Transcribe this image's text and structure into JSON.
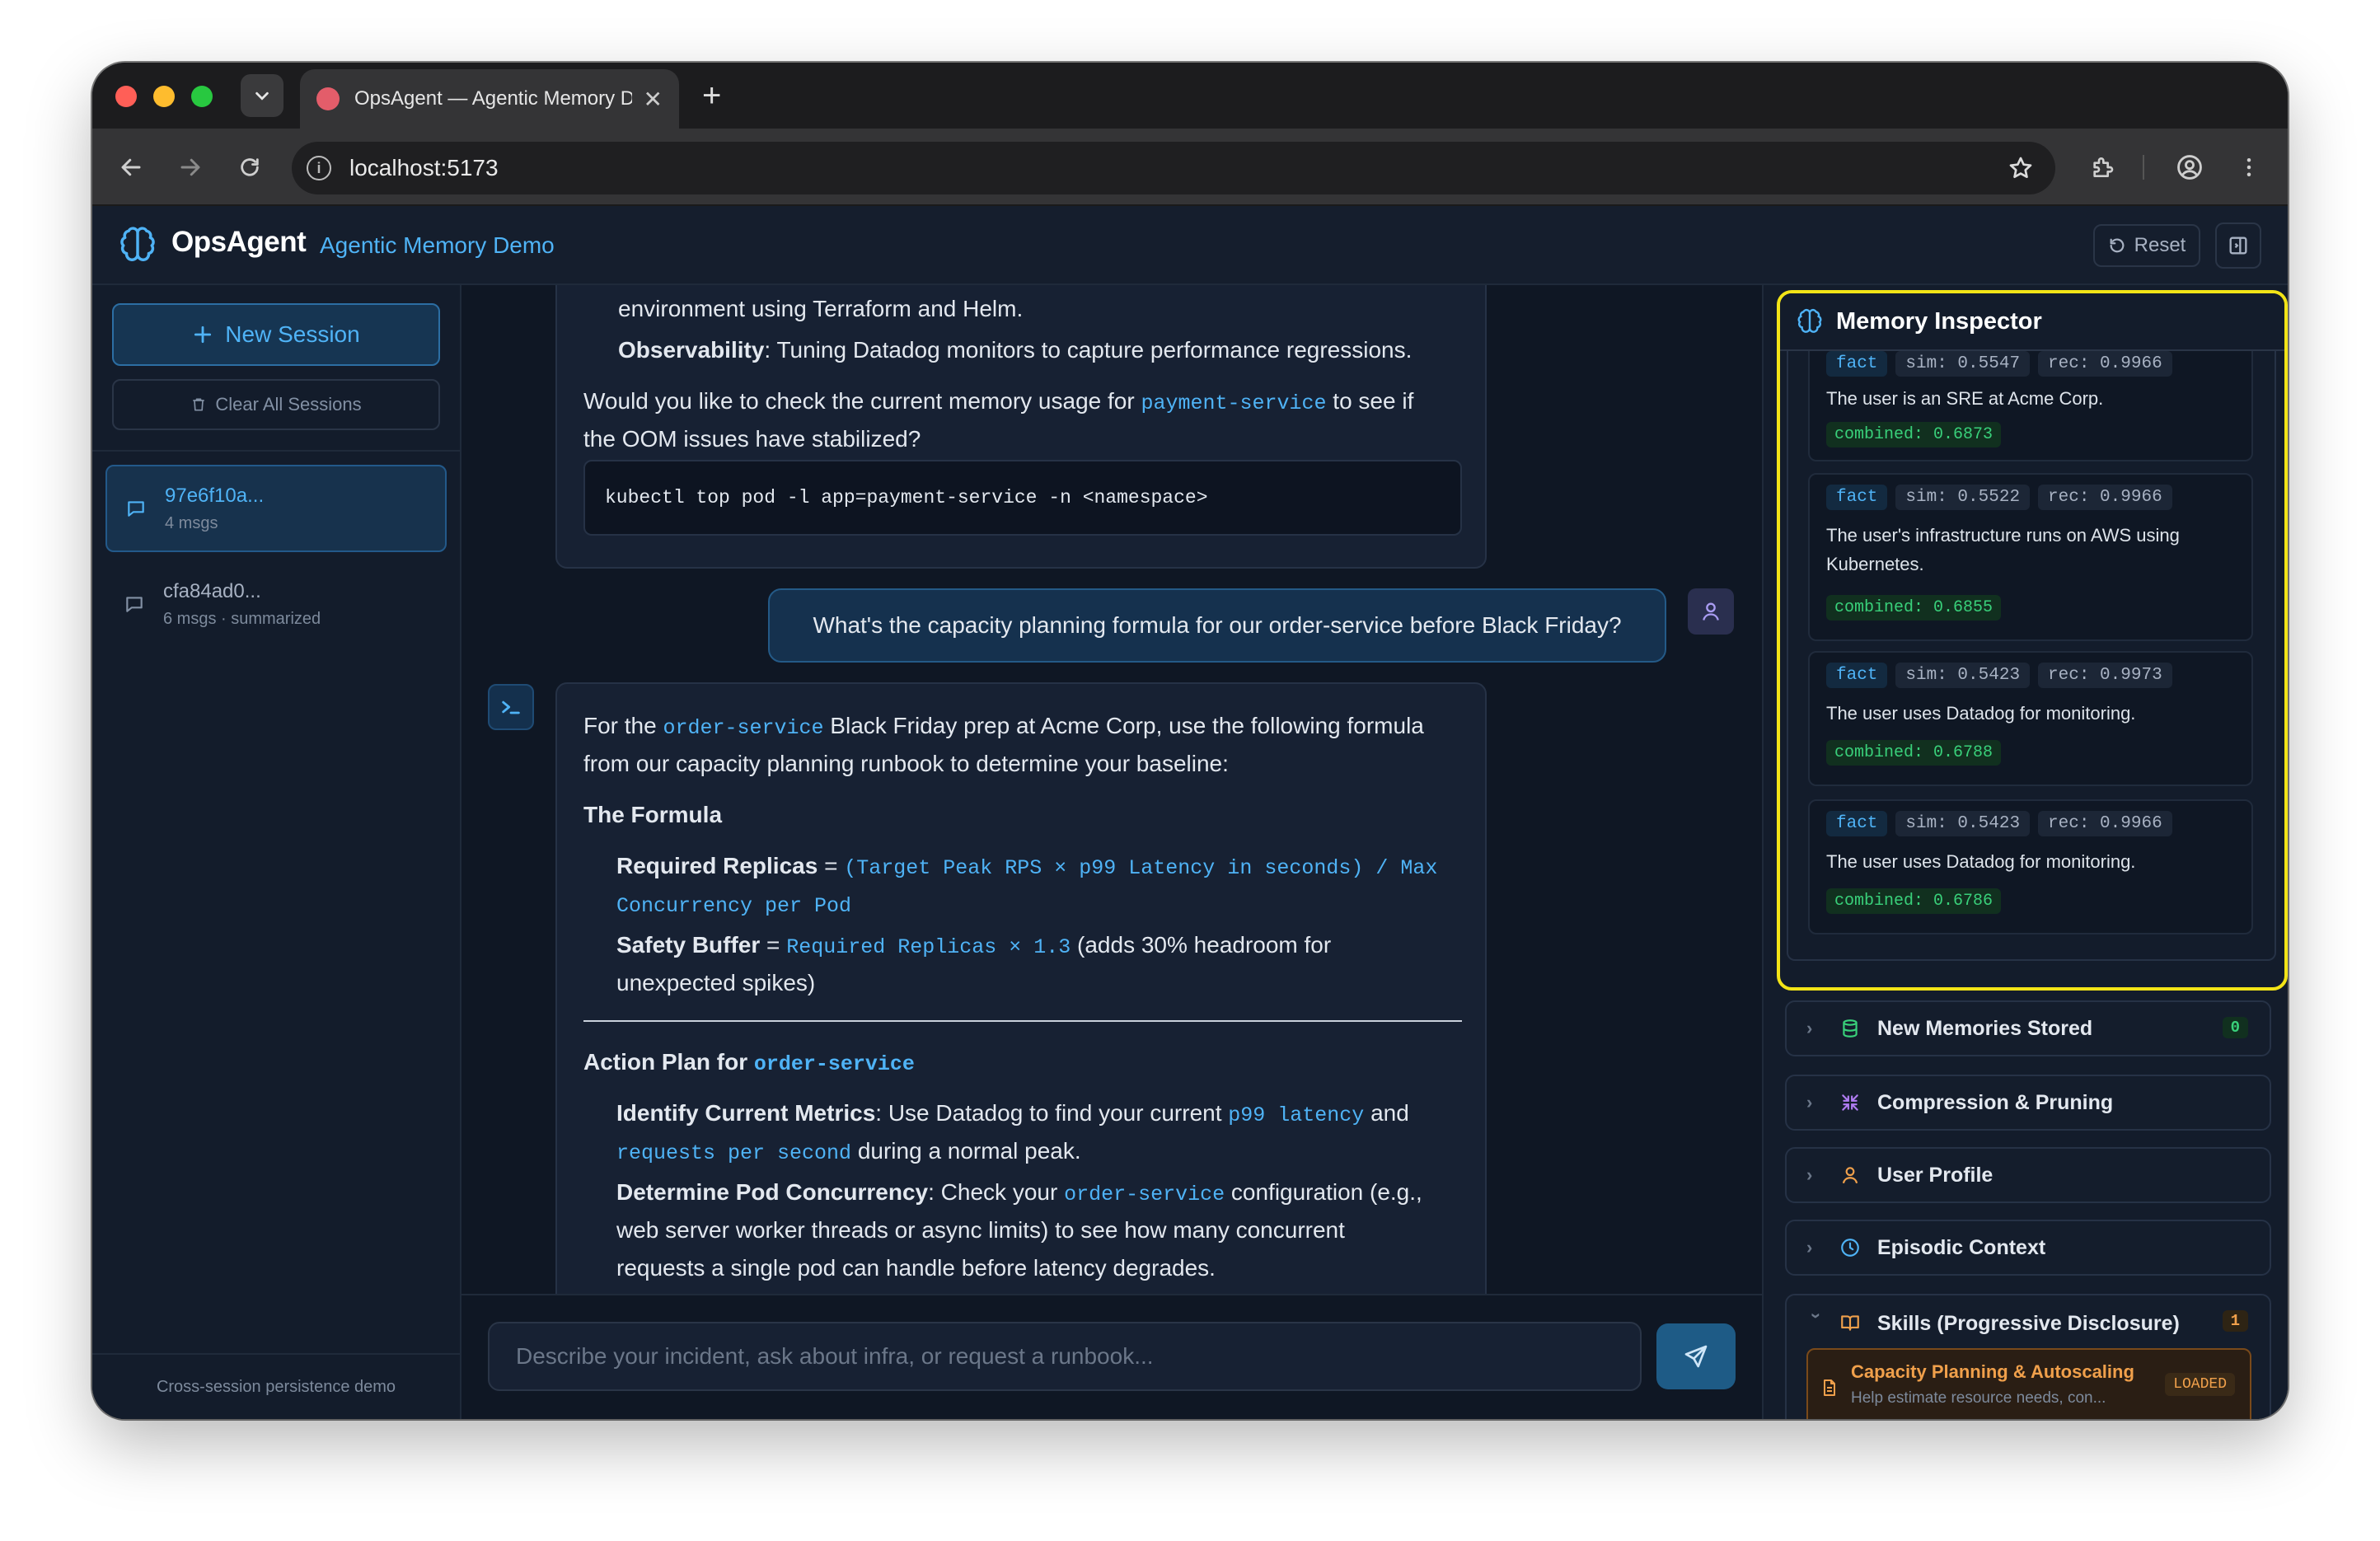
{
  "browser": {
    "tab_title": "OpsAgent — Agentic Memory Demo",
    "url": "localhost:5173"
  },
  "app": {
    "brand": "OpsAgent",
    "subtitle": "Agentic Memory Demo",
    "reset_label": "Reset"
  },
  "sidebar": {
    "new_session_label": "New Session",
    "clear_all_label": "Clear All Sessions",
    "sessions": [
      {
        "id": "97e6f10a...",
        "meta": "4 msgs",
        "active": true
      },
      {
        "id": "cfa84ad0...",
        "meta": "6 msgs · summarized",
        "active": false
      }
    ],
    "footer": "Cross-session persistence demo"
  },
  "chat": {
    "msg1": {
      "line_env": "environment using Terraform and Helm.",
      "obs_label": "Observability",
      "obs_text": ": Tuning Datadog monitors to capture performance regressions.",
      "q_pre": "Would you like to check the current memory usage for ",
      "q_code": "payment-service",
      "q_post": " to see if",
      "q_line2": "the OOM issues have stabilized?",
      "command": "kubectl top pod -l app=payment-service -n <namespace>"
    },
    "user_msg": "What's the capacity planning formula for our order-service before Black Friday?",
    "msg2": {
      "intro_pre": "For the ",
      "intro_code": "order-service",
      "intro_post": " Black Friday prep at Acme Corp, use the following formula",
      "intro_line2": "from our capacity planning runbook to determine your baseline:",
      "formula_heading": "The Formula",
      "rr_label": "Required Replicas",
      "rr_eq": " = ",
      "rr_code1": "(Target Peak RPS × p99 Latency in seconds) / Max",
      "rr_code2": "Concurrency per Pod",
      "sb_label": "Safety Buffer",
      "sb_eq": " = ",
      "sb_code": "Required Replicas × 1.3",
      "sb_post": " (adds 30% headroom for",
      "sb_line2": "unexpected spikes)",
      "plan_heading": "Action Plan for ",
      "plan_code": "order-service",
      "icm_label": "Identify Current Metrics",
      "icm_text": ": Use Datadog to find your current ",
      "icm_code1": "p99 latency",
      "icm_and": " and",
      "icm_code2": "requests per second",
      "icm_post": " during a normal peak.",
      "dpc_label": "Determine Pod Concurrency",
      "dpc_text": ": Check your ",
      "dpc_code": "order-service",
      "dpc_post": " configuration (e.g.,",
      "dpc_line2": "web server worker threads or async limits) to see how many concurrent",
      "dpc_line3": "requests a single pod can handle before latency degrades."
    },
    "input_placeholder": "Describe your incident, ask about infra, or request a runbook..."
  },
  "memory_inspector": {
    "title": "Memory Inspector",
    "cards": [
      {
        "type": "fact",
        "sim": "sim: 0.5547",
        "rec": "rec: 0.9966",
        "text": "The user is an SRE at Acme Corp.",
        "combined": "combined: 0.6873"
      },
      {
        "type": "fact",
        "sim": "sim: 0.5522",
        "rec": "rec: 0.9966",
        "text": "The user's infrastructure runs on AWS using Kubernetes.",
        "combined": "combined: 0.6855"
      },
      {
        "type": "fact",
        "sim": "sim: 0.5423",
        "rec": "rec: 0.9973",
        "text": "The user uses Datadog for monitoring.",
        "combined": "combined: 0.6788"
      },
      {
        "type": "fact",
        "sim": "sim: 0.5423",
        "rec": "rec: 0.9966",
        "text": "The user uses Datadog for monitoring.",
        "combined": "combined: 0.6786"
      }
    ],
    "sections": [
      {
        "label": "New Memories Stored",
        "count": "0"
      },
      {
        "label": "Compression & Pruning"
      },
      {
        "label": "User Profile"
      },
      {
        "label": "Episodic Context"
      },
      {
        "label": "Skills (Progressive Disclosure)",
        "count": "1"
      }
    ],
    "skill": {
      "name": "Capacity Planning & Autoscaling",
      "desc": "Help estimate resource needs, con...",
      "status": "LOADED"
    }
  },
  "colors": {
    "accent": "#4fb3f6",
    "background": "#0f1724",
    "highlight_border": "#f3e417",
    "combined_green": "#39d07a",
    "skill_orange": "#f0a04b"
  }
}
